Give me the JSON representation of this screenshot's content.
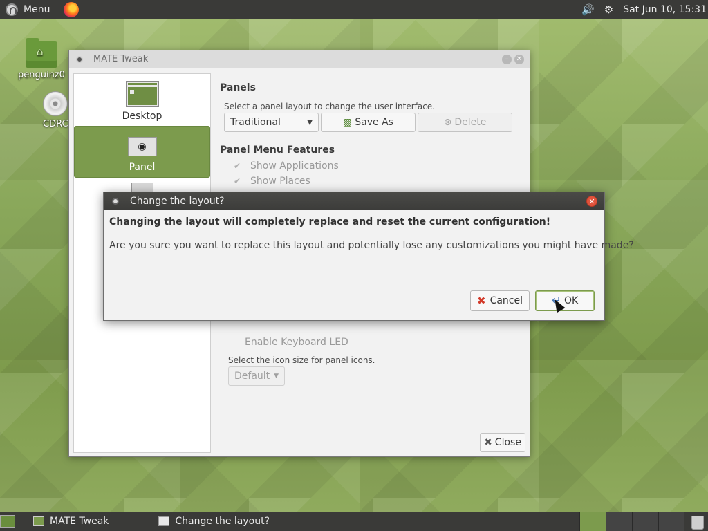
{
  "top_panel": {
    "menu_label": "Menu",
    "clock": "Sat Jun 10, 15:31"
  },
  "desktop_icons": [
    {
      "label": "penguinz0"
    },
    {
      "label": "CDRC"
    }
  ],
  "tweak": {
    "title": "MATE Tweak",
    "sidebar": [
      {
        "label": "Desktop"
      },
      {
        "label": "Panel"
      }
    ],
    "panels_title": "Panels",
    "panels_hint": "Select a panel layout to change the user interface.",
    "layout_selected": "Traditional",
    "save_as_label": "Save As",
    "delete_label": "Delete",
    "menu_features_title": "Panel Menu Features",
    "show_applications": "Show Applications",
    "show_places": "Show Places",
    "keyboard_led": "Enable Keyboard LED",
    "icon_size_hint": "Select the icon size for panel icons.",
    "icon_size_selected": "Default",
    "close_label": "Close"
  },
  "dialog": {
    "title": "Change the layout?",
    "message_bold": "Changing the layout will completely replace and reset the current configuration!",
    "message": "Are you sure you want to replace this layout and potentially lose any customizations you might have made?",
    "cancel_label": "Cancel",
    "ok_label": "OK"
  },
  "taskbar": {
    "tasks": [
      {
        "label": "MATE Tweak"
      },
      {
        "label": "Change the layout?"
      }
    ]
  },
  "colors": {
    "accent": "#7c9b4d",
    "panel_bg": "#3a3a38",
    "close_red": "#e0533c"
  }
}
